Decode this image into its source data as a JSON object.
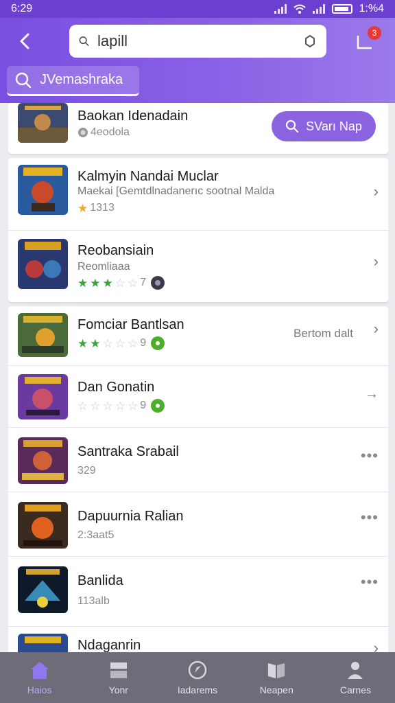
{
  "status": {
    "time": "6:29",
    "right_text": "1:%4"
  },
  "header": {
    "search_value": "lapill",
    "cart_badge": "3",
    "chip_label": "JVemashraka"
  },
  "featured": {
    "title": "Baokan Idenadain",
    "meta": "4eodola",
    "button_label": "SVarı Nap"
  },
  "items": [
    {
      "title": "Kalmyin Nandai Muclar",
      "subtitle": "Maekai [Gemtdlnadanerıc sootnal Malda",
      "meta": "1313",
      "stars_green": 0,
      "stars_gray": 0,
      "action": "chevron",
      "rating_text": ""
    },
    {
      "title": "Reobansiain",
      "subtitle": "Reomliaaa",
      "meta": "7",
      "stars_green": 3,
      "stars_gray": 2,
      "action": "chevron",
      "rating_text": ""
    },
    {
      "title": "Fomciar Bantlsan",
      "subtitle": "",
      "meta": "9",
      "stars_green": 2,
      "stars_gray": 3,
      "action": "chevron",
      "rating_text": "Bertom dalt"
    },
    {
      "title": "Dan Gonatin",
      "subtitle": "",
      "meta": "9",
      "stars_green": 0,
      "stars_gray": 5,
      "action": "arrow",
      "rating_text": ""
    },
    {
      "title": "Santraka Srabail",
      "subtitle": "",
      "meta": "329",
      "stars_green": 0,
      "stars_gray": 0,
      "action": "dots",
      "rating_text": ""
    },
    {
      "title": "Dapuurnia Ralian",
      "subtitle": "",
      "meta": "2:3aat5",
      "stars_green": 0,
      "stars_gray": 0,
      "action": "dots",
      "rating_text": ""
    },
    {
      "title": "Banlida",
      "subtitle": "",
      "meta": "113alb",
      "stars_green": 0,
      "stars_gray": 0,
      "action": "dots",
      "rating_text": ""
    },
    {
      "title": "Ndaganrin",
      "subtitle": "",
      "meta": "",
      "stars_green": 0,
      "stars_gray": 0,
      "action": "chevron",
      "rating_text": ""
    }
  ],
  "nav": [
    {
      "label": "Haios",
      "icon": "home-icon"
    },
    {
      "label": "Yonr",
      "icon": "box-icon"
    },
    {
      "label": "Iadarems",
      "icon": "compass-icon"
    },
    {
      "label": "Neapen",
      "icon": "book-icon"
    },
    {
      "label": "Carnes",
      "icon": "person-icon"
    }
  ],
  "colors": {
    "header": "#7a4ee0",
    "accent": "#8b62e0",
    "nav_bg": "#6e6c78",
    "nav_active": "#b8a6f6"
  }
}
